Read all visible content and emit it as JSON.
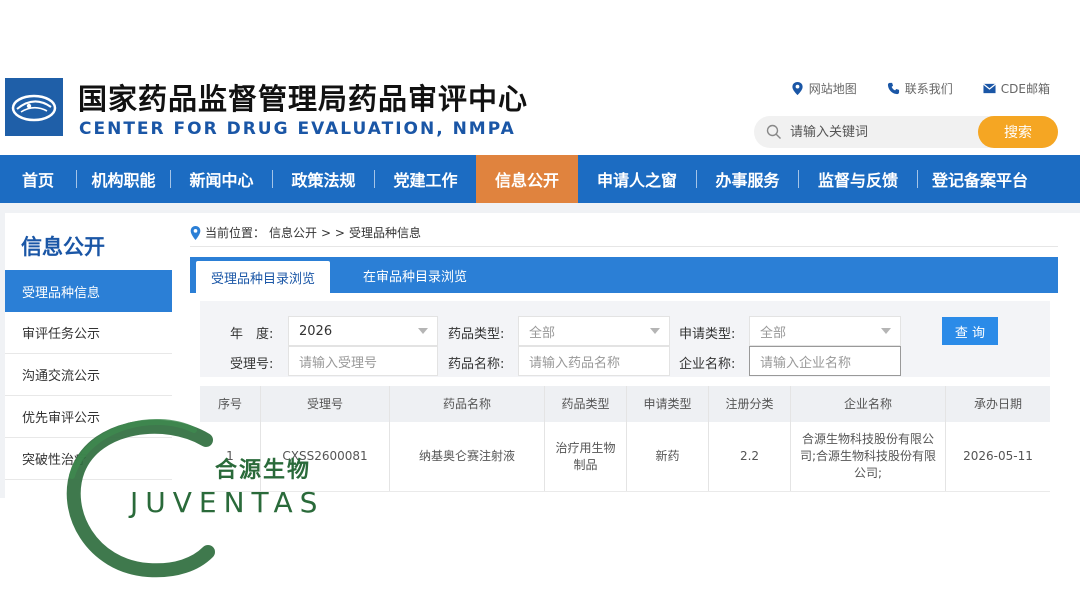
{
  "header": {
    "title_cn": "国家药品监督管理局药品审评中心",
    "title_en": "CENTER FOR DRUG EVALUATION, NMPA",
    "top_links": [
      "网站地图",
      "联系我们",
      "CDE邮箱"
    ],
    "search_placeholder": "请输入关键词",
    "search_button": "搜索"
  },
  "nav": {
    "items": [
      "首页",
      "机构职能",
      "新闻中心",
      "政策法规",
      "党建工作",
      "信息公开",
      "申请人之窗",
      "办事服务",
      "监督与反馈",
      "登记备案平台"
    ],
    "active": "信息公开"
  },
  "sidebar": {
    "title": "信息公开",
    "items": [
      "受理品种信息",
      "审评任务公示",
      "沟通交流公示",
      "优先审评公示",
      "突破性治疗"
    ]
  },
  "breadcrumb": {
    "prefix": "当前位置：",
    "path": "信息公开",
    "separator": "> >",
    "current": "受理品种信息"
  },
  "tabs": [
    "受理品种目录浏览",
    "在审品种目录浏览"
  ],
  "filter": {
    "year_label": "年　度:",
    "year_value": "2026",
    "drug_type_label": "药品类型:",
    "drug_type_value": "全部",
    "apply_type_label": "申请类型:",
    "apply_type_value": "全部",
    "accept_no_label": "受理号:",
    "accept_no_placeholder": "请输入受理号",
    "drug_name_label": "药品名称:",
    "drug_name_placeholder": "请输入药品名称",
    "company_label": "企业名称:",
    "company_placeholder": "请输入企业名称",
    "query_button": "查 询"
  },
  "table": {
    "columns": [
      "序号",
      "受理号",
      "药品名称",
      "药品类型",
      "申请类型",
      "注册分类",
      "企业名称",
      "承办日期"
    ],
    "rows": [
      [
        "1",
        "CXSS2600081",
        "纳基奥仑赛注射液",
        "治疗用生物制品",
        "新药",
        "2.2",
        "合源生物科技股份有限公司;合源生物科技股份有限公司;",
        "2026-05-11"
      ]
    ]
  },
  "watermark": {
    "text_cn": "合源生物",
    "text_en": "JUVENTAS"
  },
  "colors": {
    "brand_blue": "#1c6cc2",
    "active_orange": "#e0833e",
    "search_orange": "#f5a623",
    "watermark_green": "#2a6a3a"
  },
  "icons": [
    "logo-emblem",
    "location-pin-icon",
    "phone-icon",
    "mail-icon",
    "search-icon",
    "chevron-down-icon"
  ]
}
